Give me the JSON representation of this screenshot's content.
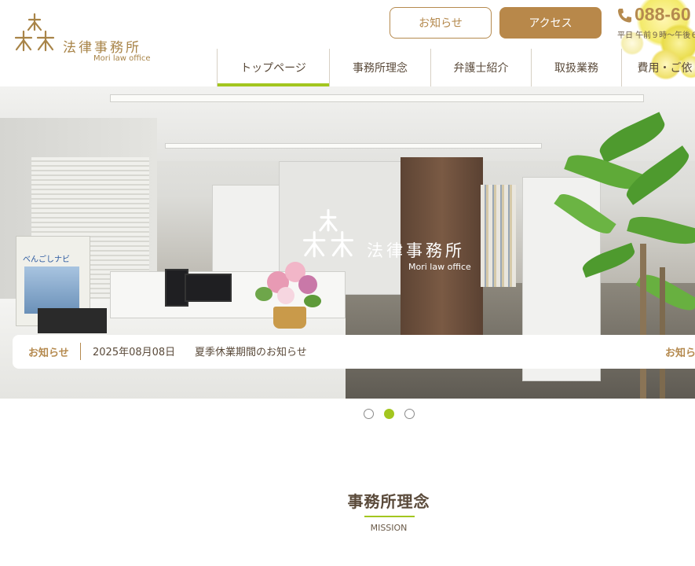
{
  "header": {
    "logo_name": "法律事務所",
    "logo_sub": "Mori law office",
    "news_button": "お知らせ",
    "access_button": "アクセス",
    "phone": "088-60",
    "hours": "平日 午前９時～午後６"
  },
  "nav": {
    "items": [
      {
        "label": "トップページ",
        "active": true
      },
      {
        "label": "事務所理念"
      },
      {
        "label": "弁護士紹介"
      },
      {
        "label": "取扱業務"
      },
      {
        "label": "費用・ご依"
      }
    ]
  },
  "hero": {
    "logo_name": "法律事務所",
    "logo_sub": "Mori law office",
    "binder_label": "べんごしナビ"
  },
  "news": {
    "tag": "お知らせ",
    "date": "2025年08月08日",
    "title": "夏季休業期間のお知らせ",
    "more": "お知ら"
  },
  "carousel": {
    "total": 3,
    "active_index": 1
  },
  "section": {
    "title": "事務所理念",
    "subtitle": "MISSION"
  },
  "colors": {
    "brand_gold": "#b8884a",
    "accent_green": "#a3c61f",
    "text_brown": "#5a4a3a"
  }
}
